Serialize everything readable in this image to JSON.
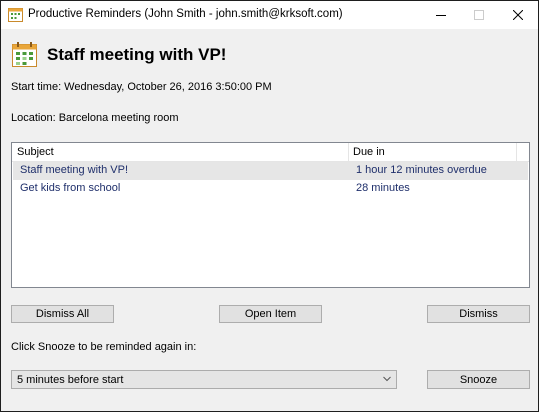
{
  "window": {
    "title": "Productive Reminders (John Smith - john.smith@krksoft.com)",
    "controls": {
      "minimize": "minimize-icon",
      "maximize": "maximize-icon",
      "close": "close-icon"
    }
  },
  "reminder": {
    "icon": "calendar-icon",
    "title": "Staff meeting with VP!",
    "start_time": "Start time: Wednesday, October 26, 2016 3:50:00 PM",
    "location": "Location: Barcelona meeting room"
  },
  "list": {
    "columns": {
      "subject": "Subject",
      "due": "Due in"
    },
    "rows": [
      {
        "subject": "Staff meeting with VP!",
        "due": "1 hour 12 minutes overdue",
        "selected": true
      },
      {
        "subject": "Get kids from school",
        "due": "28 minutes",
        "selected": false
      }
    ]
  },
  "buttons": {
    "dismiss_all": "Dismiss All",
    "open_item": "Open Item",
    "dismiss": "Dismiss",
    "snooze": "Snooze"
  },
  "snooze": {
    "label": "Click Snooze to be reminded again in:",
    "selected_option": "5 minutes before start"
  },
  "colors": {
    "row_text": "#1f2f6b",
    "selected_row": "#e6e6e6",
    "button_face": "#e1e1e1",
    "window_bg": "#f0f0f0"
  }
}
